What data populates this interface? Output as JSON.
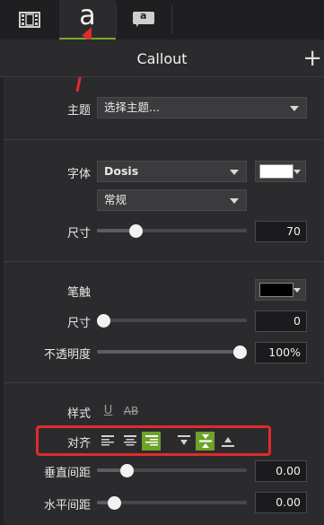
{
  "header": {
    "title": "Callout",
    "add_label": "+"
  },
  "tabs": [
    {
      "name": "film",
      "icon": "film-icon"
    },
    {
      "name": "text",
      "label": "a",
      "icon": "text-a-icon"
    },
    {
      "name": "callout",
      "label": "a",
      "icon": "callout-icon"
    }
  ],
  "theme": {
    "label": "主题",
    "value": "选择主题..."
  },
  "font": {
    "label": "字体",
    "family": "Dosis",
    "style": "常规",
    "color": "#ffffff",
    "size_label": "尺寸",
    "size_value": "70",
    "size_level": 0.24
  },
  "stroke": {
    "label": "笔触",
    "color": "#000000",
    "size_label": "尺寸",
    "size_value": "0",
    "size_level": 0.0,
    "opacity_label": "不透明度",
    "opacity_value": "100%",
    "opacity_level": 1.0
  },
  "style_row": {
    "label": "样式",
    "underline": "U",
    "strikethrough": "AB"
  },
  "align_row": {
    "label": "对齐",
    "horizontal_active": "right",
    "vertical_active": "middle"
  },
  "vertical_spacing": {
    "label": "垂直间距",
    "value": "0.00",
    "level": 0.17
  },
  "horizontal_spacing": {
    "label": "水平间距",
    "value": "0.00",
    "level": 0.08
  },
  "colors": {
    "accent": "#6da328",
    "annotation": "#e12b2b"
  }
}
